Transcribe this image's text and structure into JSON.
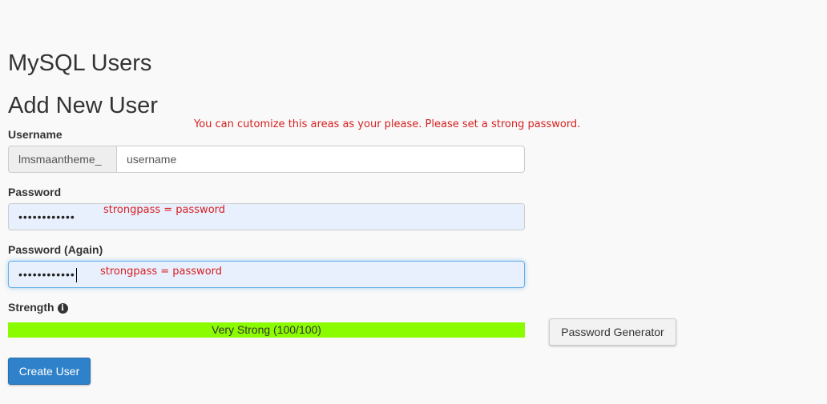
{
  "page": {
    "title": "MySQL Users",
    "section_title": "Add New User"
  },
  "annotations": {
    "top_note": "You can cutomize this areas as your please. Please set a strong password.",
    "password_note": "strongpass = password",
    "password_again_note": "strongpass = password"
  },
  "form": {
    "username_label": "Username",
    "username_prefix": "lmsmaantheme_",
    "username_value": "username",
    "password_label": "Password",
    "password_value": "••••••••••••",
    "password_again_label": "Password (Again)",
    "password_again_value": "••••••••••••",
    "strength_label": "Strength",
    "strength_text": "Very Strong (100/100)",
    "strength_percent": 100,
    "generator_button": "Password Generator",
    "create_button": "Create User"
  },
  "icons": {
    "strength_info": "info-circle-icon"
  },
  "colors": {
    "strength_fill": "#8bfc00",
    "annotation": "#d81e1e",
    "primary": "#2f82ca"
  }
}
